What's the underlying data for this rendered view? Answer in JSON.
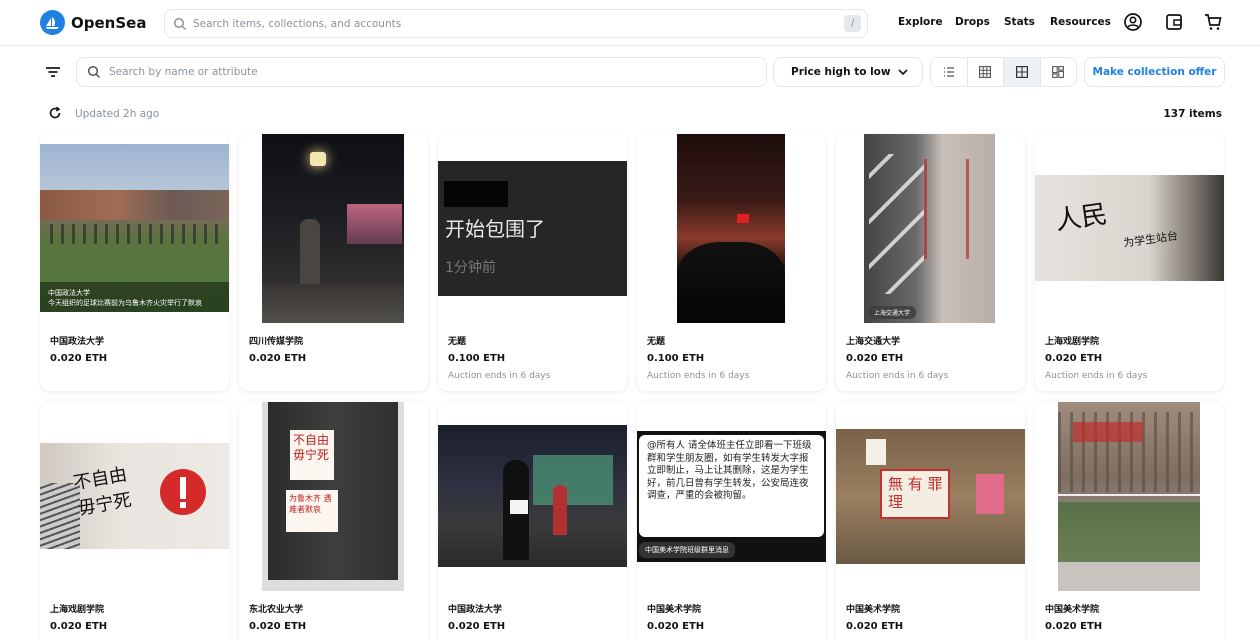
{
  "brand": {
    "name": "OpenSea"
  },
  "header": {
    "search_placeholder": "Search items, collections, and accounts",
    "shortcut_key": "/",
    "nav": [
      "Explore",
      "Drops",
      "Stats",
      "Resources"
    ],
    "icons": [
      "account-icon",
      "wallet-icon",
      "cart-icon"
    ]
  },
  "toolbar": {
    "attr_search_placeholder": "Search by name or attribute",
    "sort_value": "Price high to low",
    "view_modes": [
      "list-view-icon",
      "grid-small-icon",
      "grid-large-icon",
      "grid-masonry-icon"
    ],
    "active_view": "grid-large-icon",
    "offer_label": "Make collection offer"
  },
  "status": {
    "updated": "Updated 2h ago",
    "count": "137 items"
  },
  "colors": {
    "accent": "#2081e2",
    "muted": "#8a939b",
    "border": "#e5e8eb"
  },
  "cards": [
    {
      "name": "中国政法大学",
      "price": "0.020 ETH",
      "sub": "",
      "caption": "中国政法大学\n今天组织的足球比赛前为乌鲁木齐火灾举行了默哀"
    },
    {
      "name": "四川传媒学院",
      "price": "0.020 ETH",
      "sub": ""
    },
    {
      "name": "无题",
      "price": "0.100 ETH",
      "sub": "Auction ends in 6 days",
      "img_text_main": "开始包围了",
      "img_text_sub": "1分钟前"
    },
    {
      "name": "无题",
      "price": "0.100 ETH",
      "sub": "Auction ends in 6 days"
    },
    {
      "name": "上海交通大学",
      "price": "0.020 ETH",
      "sub": "Auction ends in 6 days",
      "tag": "上海交通大学"
    },
    {
      "name": "上海戏剧学院",
      "price": "0.020 ETH",
      "sub": "Auction ends in 6 days",
      "img_text_main": "人民",
      "img_text_sub": "为学生站台"
    },
    {
      "name": "上海戏剧学院",
      "price": "0.020 ETH",
      "sub": "",
      "img_text_main": "不自由 毋宁死"
    },
    {
      "name": "东北农业大学",
      "price": "0.020 ETH",
      "sub": "",
      "img_text_main": "不自由 毋宁死",
      "img_text_sub": "为鲁木齐 遇难者默哀"
    },
    {
      "name": "中国政法大学",
      "price": "0.020 ETH",
      "sub": ""
    },
    {
      "name": "中国美术学院",
      "price": "0.020 ETH",
      "sub": "",
      "img_text_main": "@所有人 请全体班主任立即看一下班级群和学生朋友圈，如有学生转发大字报立即制止，马上让其删除，这是为学生好，前几日曾有学生转发，公安局连夜调查，严重的会被拘留。",
      "tag": "中国美术学院班级群里消息"
    },
    {
      "name": "中国美术学院",
      "price": "0.020 ETH",
      "sub": "",
      "img_text_main": "無 有 罪 理"
    },
    {
      "name": "中国美术学院",
      "price": "0.020 ETH",
      "sub": ""
    }
  ]
}
